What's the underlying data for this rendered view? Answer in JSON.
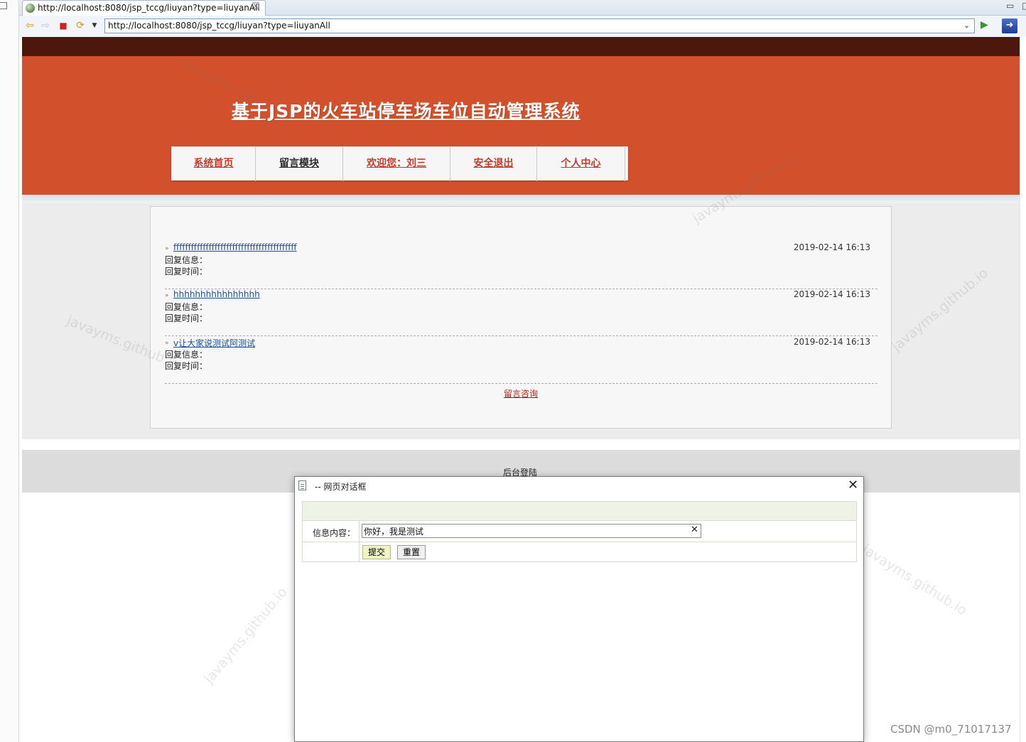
{
  "browser": {
    "tab_title": "http://localhost:8080/jsp_tccg/liuyan?type=liuyanAll",
    "url": "http://localhost:8080/jsp_tccg/liuyan?type=liuyanAll"
  },
  "site": {
    "title": "基于JSP的火车站停车场车位自动管理系统",
    "menu": [
      {
        "label": "系统首页",
        "color": "#c43a2a"
      },
      {
        "label": "留言模块",
        "color": "#2b2b2b"
      },
      {
        "label": "欢迎您：刘三",
        "color": "#c43a2a"
      },
      {
        "label": "安全退出",
        "color": "#c43a2a"
      },
      {
        "label": "个人中心",
        "color": "#c43a2a"
      }
    ]
  },
  "messages": [
    {
      "title": "ffffffffffffffffffffffffffffffffffffffffff",
      "date": "2019-02-14 16:13",
      "reply_label": "回复信息：",
      "reply_time_label": "回复时间："
    },
    {
      "title": "hhhhhhhhhhhhhhhh",
      "date": "2019-02-14 16:13",
      "reply_label": "回复信息：",
      "reply_time_label": "回复时间："
    },
    {
      "title": "v让大家说测试阿测试",
      "date": "2019-02-14 16:13",
      "reply_label": "回复信息：",
      "reply_time_label": "回复时间："
    }
  ],
  "consult_link": "留言咨询",
  "admin_login": "后台登陆",
  "dialog": {
    "title": "-- 网页对话框",
    "field_label": "信息内容：",
    "field_value": "你好，我是测试",
    "submit_label": "提交",
    "reset_label": "重置"
  },
  "watermark": "javayms.github.io",
  "credit": "CSDN @m0_71017137",
  "colors": {
    "banner": "#d2502b",
    "top_band": "#4e170b",
    "link_red": "#b0231c",
    "link_blue": "#1a4e9c"
  }
}
